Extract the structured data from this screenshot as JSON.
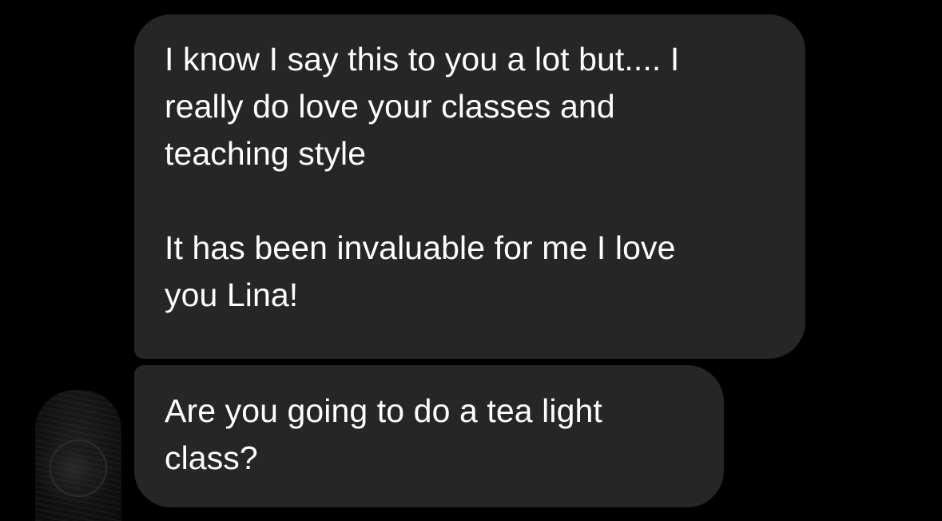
{
  "messages": [
    {
      "sender": "other",
      "paragraphs": [
        "I know I say this to you a lot but.... I\nreally do love your classes and\nteaching style",
        "It has been invaluable for me I love\nyou Lina!"
      ]
    },
    {
      "sender": "other",
      "paragraphs": [
        "Are you going to do a tea light\nclass?"
      ]
    }
  ],
  "colors": {
    "background": "#000000",
    "bubble": "#262626",
    "text": "#ffffff"
  },
  "avatar": {
    "icon": "user-avatar-photo"
  }
}
